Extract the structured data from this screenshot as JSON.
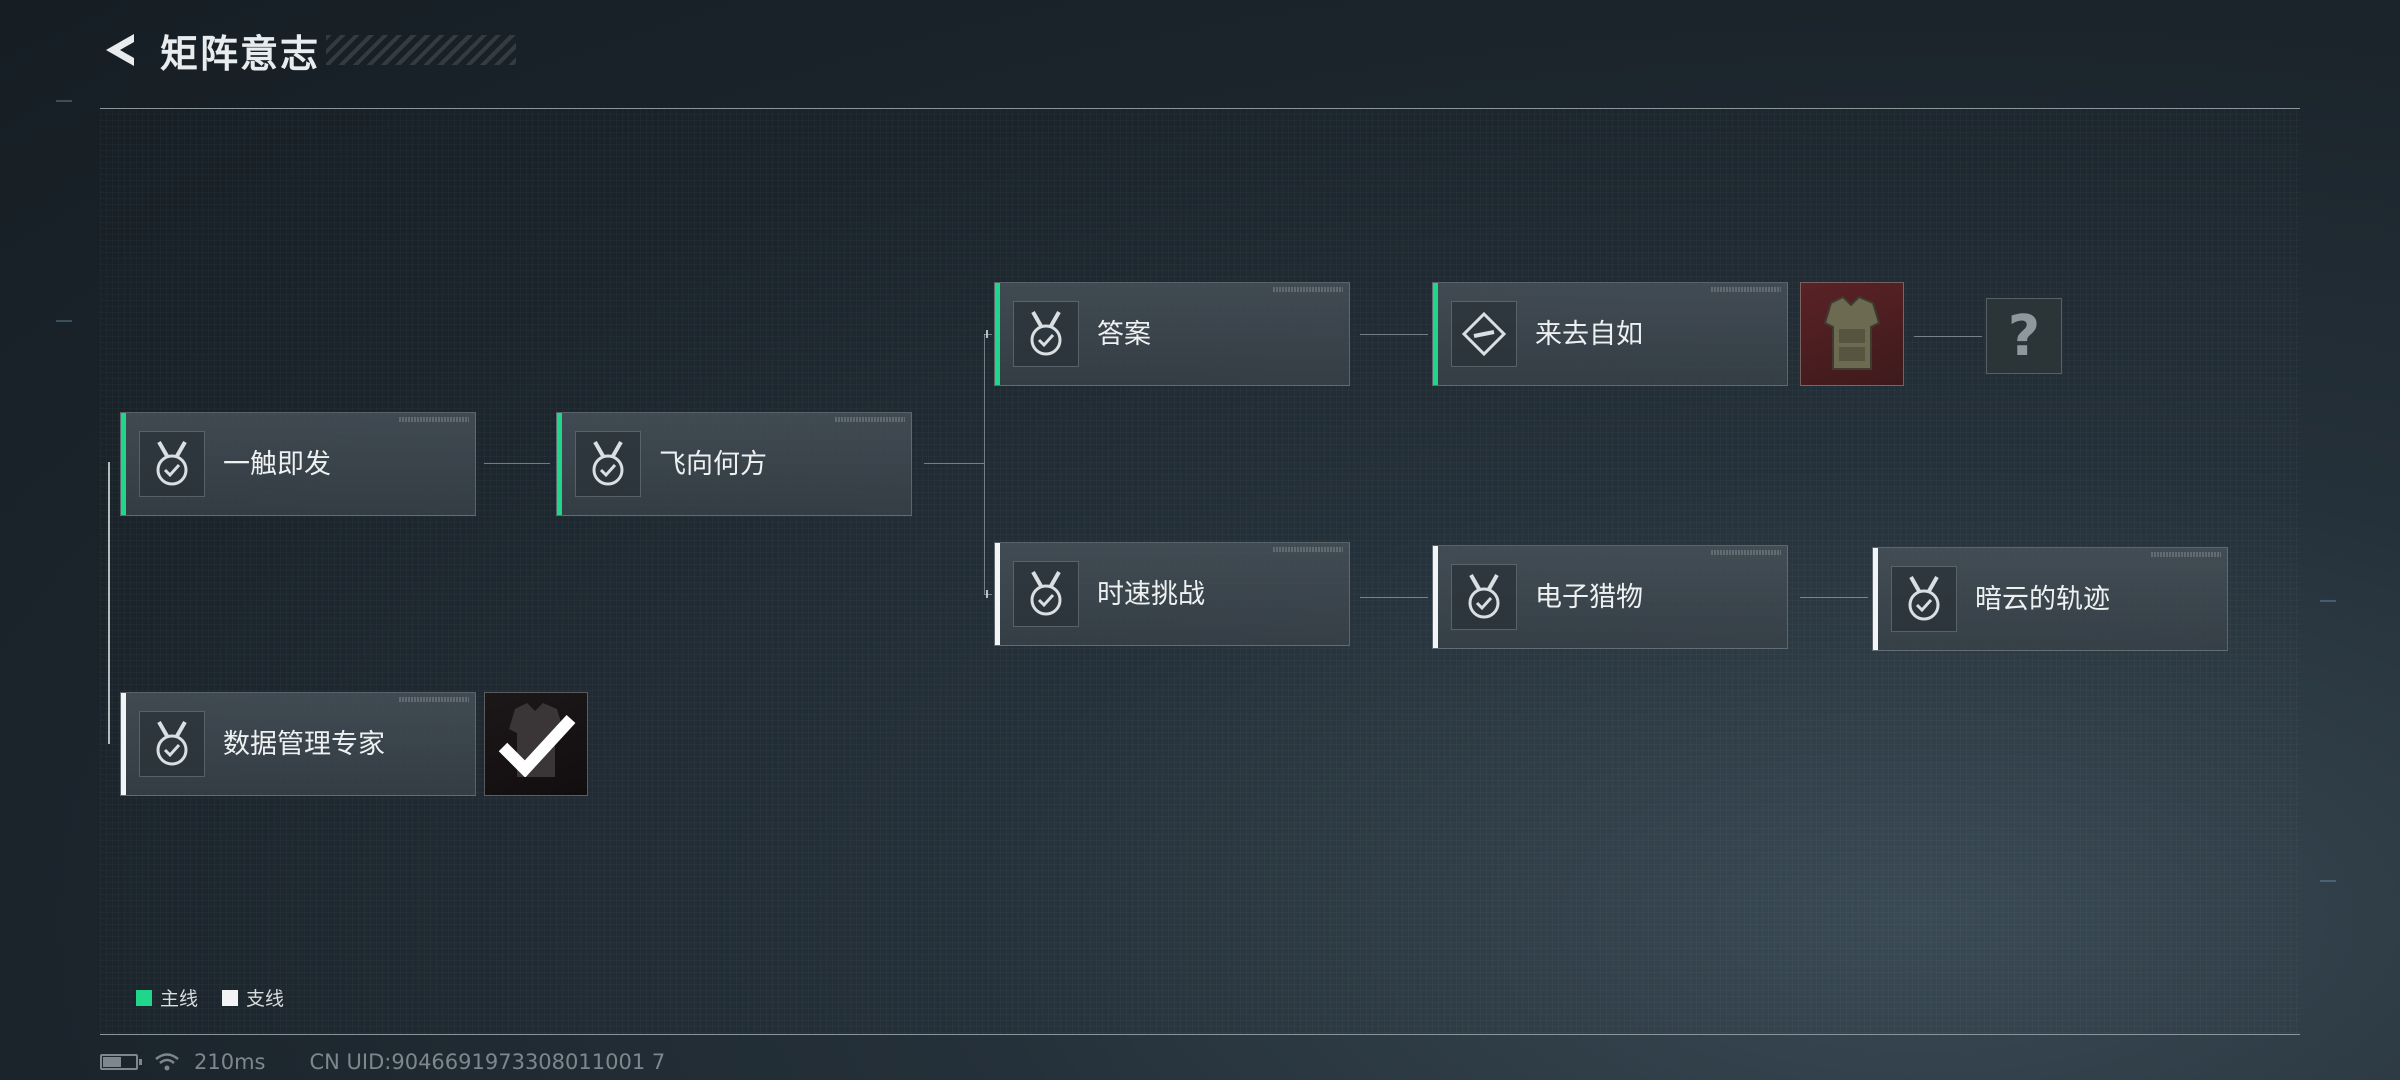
{
  "header": {
    "title": "矩阵意志"
  },
  "nodes": {
    "yichu": {
      "label": "一触即发",
      "line": "main"
    },
    "feixiang": {
      "label": "飞向何方",
      "line": "main"
    },
    "daan": {
      "label": "答案",
      "line": "main"
    },
    "laiqu": {
      "label": "来去自如",
      "line": "main"
    },
    "shisu": {
      "label": "时速挑战",
      "line": "branch"
    },
    "dianzi": {
      "label": "电子猎物",
      "line": "branch"
    },
    "anyun": {
      "label": "暗云的轨迹",
      "line": "branch"
    },
    "shuju": {
      "label": "数据管理专家",
      "line": "branch"
    }
  },
  "rewards": {
    "unknown_symbol": "?"
  },
  "legend": {
    "main_label": "主线",
    "main_color": "#1fd68a",
    "branch_label": "支线",
    "branch_color": "#f2f4f5"
  },
  "footer": {
    "battery_level": 0.6,
    "ping": "210ms",
    "uid": "CN UID:9046691973308011001 7"
  },
  "colors": {
    "main": "#1fd68a",
    "branch": "#f2f4f5"
  }
}
